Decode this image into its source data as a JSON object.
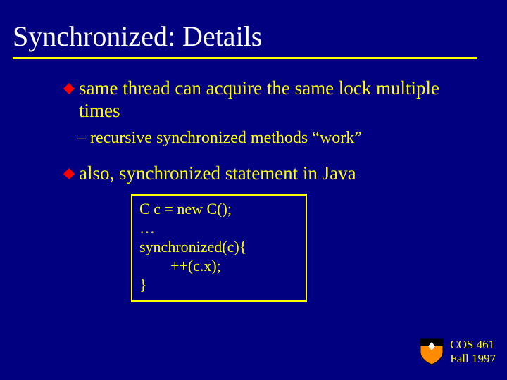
{
  "title": "Synchronized: Details",
  "bullets": [
    {
      "text": "same thread can acquire the same lock multiple times"
    },
    {
      "text": "also, synchronized statement in Java"
    }
  ],
  "subpoint": "– recursive synchronized methods “work”",
  "code": "C c = new C();\n…\nsynchronized(c){\n        ++(c.x);\n}",
  "footer": {
    "course": "COS 461",
    "term": "Fall 1997"
  }
}
